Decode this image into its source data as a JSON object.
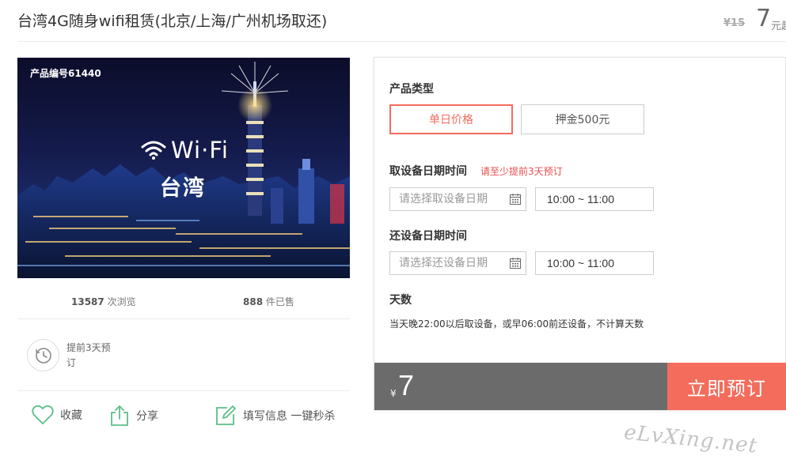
{
  "header": {
    "title": "台湾4G随身wifi租赁(北京/上海/广州机场取还)",
    "original_price": "¥15",
    "price": "7",
    "price_unit": "元起"
  },
  "product_image": {
    "code_label": "产品编号61440",
    "wifi_text": "Wi·Fi",
    "region_text": "台湾"
  },
  "stats": {
    "views_count": "13587",
    "views_label": "次浏览",
    "sold_count": "888",
    "sold_label": "件已售"
  },
  "advance": {
    "text": "提前3天预订"
  },
  "actions": {
    "favorite": "收藏",
    "share": "分享",
    "fill_info": "填写信息 一键秒杀"
  },
  "booking": {
    "type_label": "产品类型",
    "type_options": [
      "单日价格",
      "押金500元"
    ],
    "pickup_label": "取设备日期时间",
    "pickup_note": "请至少提前3天预订",
    "pickup_placeholder": "请选择取设备日期",
    "pickup_time": "10:00 ~ 11:00",
    "return_label": "还设备日期时间",
    "return_placeholder": "请选择还设备日期",
    "return_time": "10:00 ~ 11:00",
    "days_label": "天数",
    "days_note": "当天晚22:00以后取设备，或早06:00前还设备，不计算天数",
    "currency": "¥",
    "total": "7",
    "book_button": "立即预订"
  },
  "watermark": "eLvXing.net",
  "colors": {
    "accent": "#f36c5c",
    "note_red": "#e94e4e",
    "total_bar": "#6b6b6b",
    "icon_green": "#5cbf8a"
  }
}
